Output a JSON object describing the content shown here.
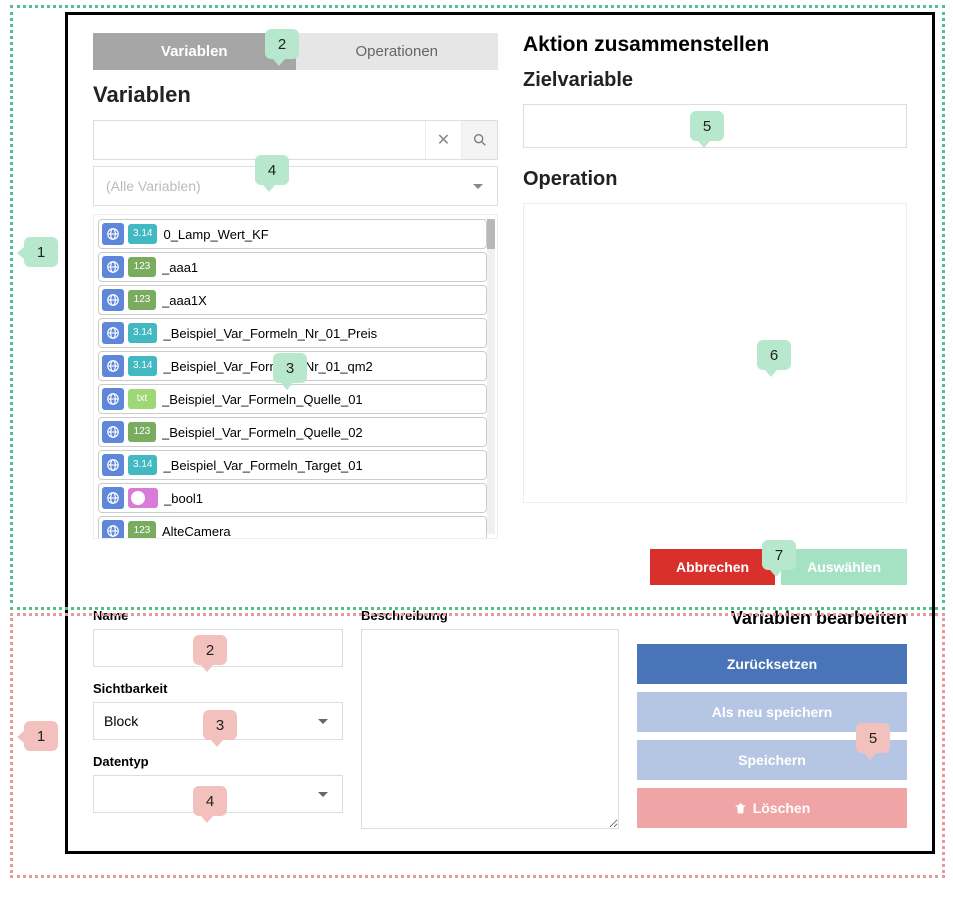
{
  "top": {
    "tabs": {
      "variables": "Variablen",
      "operations": "Operationen"
    },
    "left_title": "Variablen",
    "search_placeholder": "",
    "filter_placeholder": "(Alle Variablen)",
    "variables": [
      {
        "type": "float",
        "type_label": "3.14",
        "name": "0_Lamp_Wert_KF"
      },
      {
        "type": "int",
        "type_label": "123",
        "name": "_aaa1"
      },
      {
        "type": "int",
        "type_label": "123",
        "name": "_aaa1X"
      },
      {
        "type": "float",
        "type_label": "3.14",
        "name": "_Beispiel_Var_Formeln_Nr_01_Preis"
      },
      {
        "type": "float",
        "type_label": "3.14",
        "name": "_Beispiel_Var_Formeln_Nr_01_qm2"
      },
      {
        "type": "txt",
        "type_label": "txt",
        "name": "_Beispiel_Var_Formeln_Quelle_01"
      },
      {
        "type": "int",
        "type_label": "123",
        "name": "_Beispiel_Var_Formeln_Quelle_02"
      },
      {
        "type": "float",
        "type_label": "3.14",
        "name": "_Beispiel_Var_Formeln_Target_01"
      },
      {
        "type": "bool",
        "type_label": "",
        "name": "_bool1"
      },
      {
        "type": "int",
        "type_label": "123",
        "name": "AlteCamera"
      }
    ],
    "right_title": "Aktion zusammenstellen",
    "target_title": "Zielvariable",
    "operation_title": "Operation",
    "buttons": {
      "cancel": "Abbrechen",
      "select": "Auswählen"
    }
  },
  "bottom": {
    "labels": {
      "name": "Name",
      "visibility": "Sichtbarkeit",
      "datatype": "Datentyp",
      "description": "Beschreibung"
    },
    "values": {
      "name": "",
      "visibility": "Block",
      "datatype": ""
    },
    "panel_title": "Variablen bearbeiten",
    "buttons": {
      "reset": "Zurücksetzen",
      "save_as_new": "Als neu speichern",
      "save": "Speichern",
      "delete": "Löschen"
    }
  },
  "callouts": {
    "green": [
      "1",
      "2",
      "3",
      "4",
      "5",
      "6",
      "7"
    ],
    "red": [
      "1",
      "2",
      "3",
      "4",
      "5"
    ]
  }
}
